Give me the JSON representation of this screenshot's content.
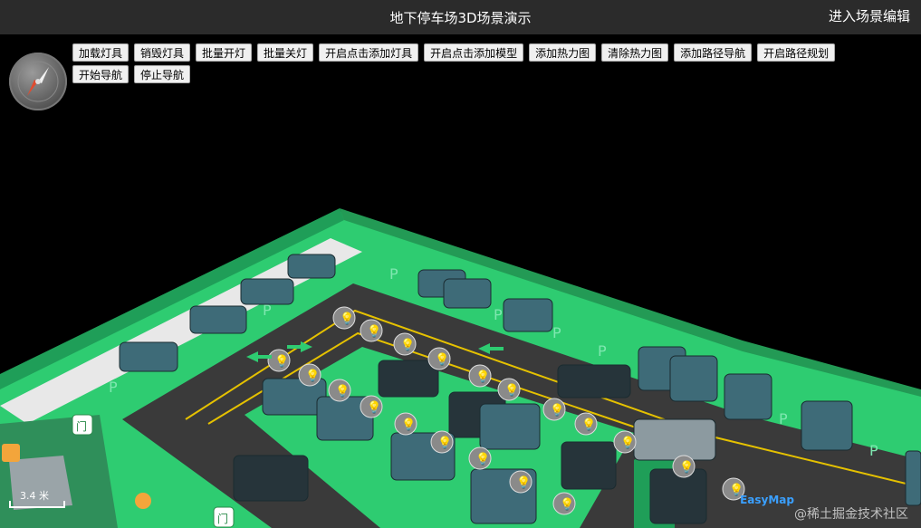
{
  "header": {
    "title": "地下停车场3D场景演示",
    "edit_link": "进入场景编辑"
  },
  "toolbar": {
    "buttons": [
      "加载灯具",
      "销毁灯具",
      "批量开灯",
      "批量关灯",
      "开启点击添加灯具",
      "开启点击添加模型",
      "添加热力图",
      "清除热力图",
      "添加路径导航",
      "开启路径规划",
      "开始导航",
      "停止导航"
    ]
  },
  "map": {
    "scale_label": "3.4 米",
    "watermark": "@稀土掘金技术社区",
    "logo_text": "EasyMap"
  },
  "colors": {
    "floor": "#2ecc71",
    "wall": "#1f9e58",
    "road": "#3a3a3a",
    "lane_line": "#e5c100",
    "car": "#3e6b78"
  }
}
